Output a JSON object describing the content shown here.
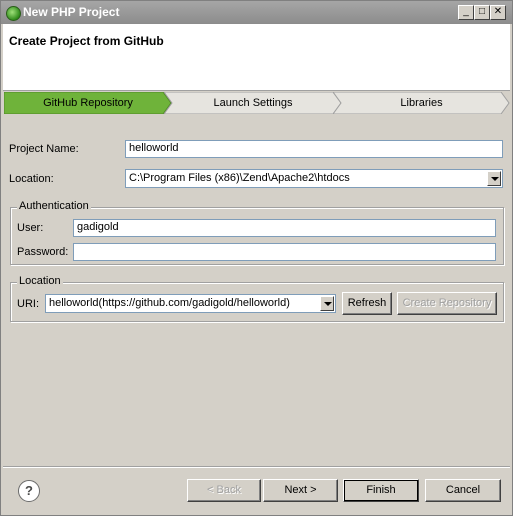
{
  "window": {
    "title": "New PHP Project"
  },
  "header": {
    "title": "Create Project from GitHub"
  },
  "steps": [
    {
      "label": "GitHub Repository",
      "active": true
    },
    {
      "label": "Launch Settings",
      "active": false
    },
    {
      "label": "Libraries",
      "active": false
    }
  ],
  "form": {
    "project_name_label": "Project Name:",
    "project_name_value": "helloworld",
    "location_label": "Location:",
    "location_value": "C:\\Program Files (x86)\\Zend\\Apache2\\htdocs"
  },
  "auth": {
    "title": "Authentication",
    "user_label": "User:",
    "user_value": "gadigold",
    "password_label": "Password:",
    "password_value": ""
  },
  "repo": {
    "title": "Location",
    "uri_label": "URI:",
    "uri_value": "helloworld(https://github.com/gadigold/helloworld)",
    "refresh_label": "Refresh",
    "create_label": "Create Repository"
  },
  "footer": {
    "help_glyph": "?",
    "back_label": "< Back",
    "next_label": "Next >",
    "finish_label": "Finish",
    "cancel_label": "Cancel"
  },
  "colors": {
    "active_step": "#6fb33a",
    "titlebar": "#999999"
  }
}
